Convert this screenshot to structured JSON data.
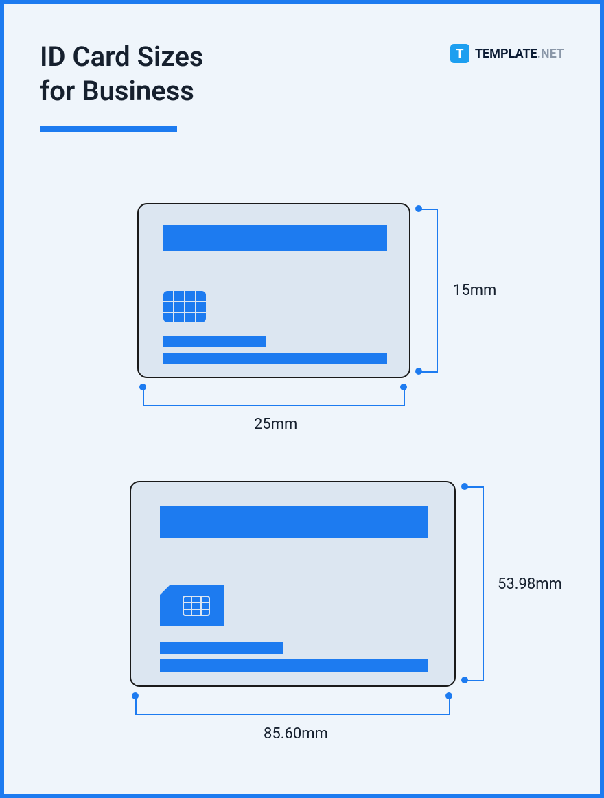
{
  "title_line1": "ID Card Sizes",
  "title_line2": "for Business",
  "brand": {
    "icon_letter": "T",
    "name": "TEMPLATE",
    "ext": ".NET"
  },
  "cards": [
    {
      "width_label": "25mm",
      "height_label": "15mm"
    },
    {
      "width_label": "85.60mm",
      "height_label": "53.98mm"
    }
  ]
}
